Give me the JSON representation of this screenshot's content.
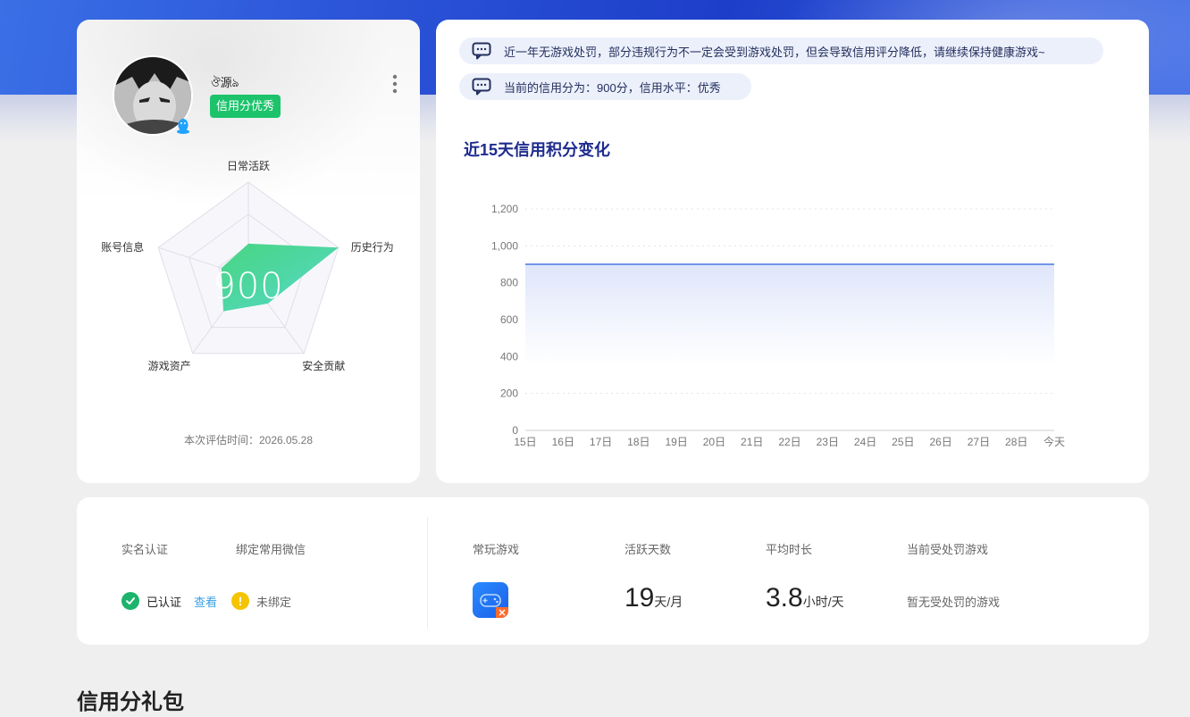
{
  "profile": {
    "nickname": "ঔ源ঌ",
    "badge": "信用分优秀",
    "score": "900",
    "eval_time": "本次评估时间：2026.05.28",
    "radar": {
      "labels": [
        "日常活跃",
        "历史行为",
        "安全贡献",
        "游戏资产",
        "账号信息"
      ],
      "values": [
        0.35,
        1.0,
        0.35,
        0.45,
        0.3
      ]
    }
  },
  "notices": [
    "近一年无游戏处罚，部分违规行为不一定会受到游戏处罚，但会导致信用评分降低，请继续保持健康游戏~",
    "当前的信用分为：900分，信用水平：优秀"
  ],
  "chart": {
    "title": "近15天信用积分变化"
  },
  "chart_data": {
    "type": "area",
    "categories": [
      "15日",
      "16日",
      "17日",
      "18日",
      "19日",
      "20日",
      "21日",
      "22日",
      "23日",
      "24日",
      "25日",
      "26日",
      "27日",
      "28日",
      "今天"
    ],
    "series": [
      {
        "values": [
          900,
          900,
          900,
          900,
          900,
          900,
          900,
          900,
          900,
          900,
          900,
          900,
          900,
          900,
          900
        ]
      }
    ],
    "yticks": [
      "0",
      "200",
      "400",
      "600",
      "800",
      "1,000",
      "1,200"
    ],
    "ylim": [
      0,
      1200
    ],
    "grid": true,
    "color": "#6f95e8"
  },
  "info": {
    "real_name_label": "实名认证",
    "wechat_label": "绑定常用微信",
    "verified_text": "已认证",
    "view_link": "查看",
    "unbound_text": "未绑定",
    "frequent_games_label": "常玩游戏",
    "active_days_label": "活跃天数",
    "active_days_value": "19",
    "active_days_unit": "天/月",
    "avg_time_label": "平均时长",
    "avg_time_value": "3.8",
    "avg_time_unit": "小时/天",
    "punished_label": "当前受处罚游戏",
    "punished_value": "暂无受处罚的游戏"
  },
  "section_title": "信用分礼包",
  "colors": {
    "accent_green": "#1cc36b",
    "accent_blue": "#1f2b8f",
    "warn_yellow": "#f5c400",
    "link_blue": "#3aa0e6"
  }
}
